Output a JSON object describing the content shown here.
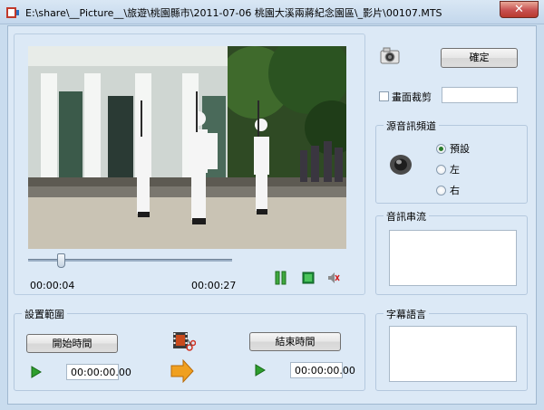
{
  "window": {
    "title": "E:\\share\\__Picture__\\旅遊\\桃園縣市\\2011-07-06 桃園大溪兩蔣紀念園區\\_影片\\00107.MTS",
    "close_label": "✕"
  },
  "player": {
    "current_time": "00:00:04",
    "total_time": "00:00:27",
    "position_fraction": 0.15
  },
  "right_panel": {
    "ok_label": "確定",
    "crop_label": "畫面裁剪",
    "crop_value": "",
    "audio_channel": {
      "title": "源音訊頻道",
      "options": [
        "預設",
        "左",
        "右"
      ],
      "selected": "預設"
    },
    "audio_stream_title": "音訊串流",
    "subtitle_title": "字幕語言"
  },
  "range": {
    "title": "設置範圍",
    "start_label": "開始時間",
    "end_label": "結束時間",
    "start_value": "00:00:00.00",
    "end_value": "00:00:00.00"
  },
  "colors": {
    "accent_play": "#2e9e2e",
    "arrow_orange": "#f0a020"
  }
}
